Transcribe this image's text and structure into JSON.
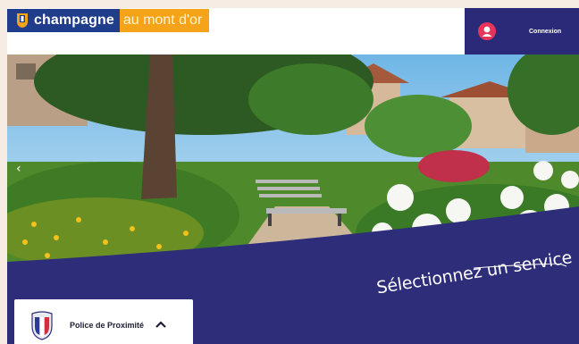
{
  "header": {
    "logo_part1": "champagne",
    "logo_part2": "au mont d'or",
    "login_label": "Connexion"
  },
  "hero": {
    "tagline": "Sélectionnez un service"
  },
  "card": {
    "label": "Police de Proximité"
  },
  "icons": [
    "coat-of-arms-icon",
    "user-icon",
    "police-badge-icon",
    "chevron-up-icon",
    "carousel-prev-icon"
  ],
  "colors": {
    "navy": "#2e2d7a",
    "logo_blue": "#1f3d8a",
    "logo_orange": "#f5a41a",
    "avatar_pink": "#e7345a"
  }
}
